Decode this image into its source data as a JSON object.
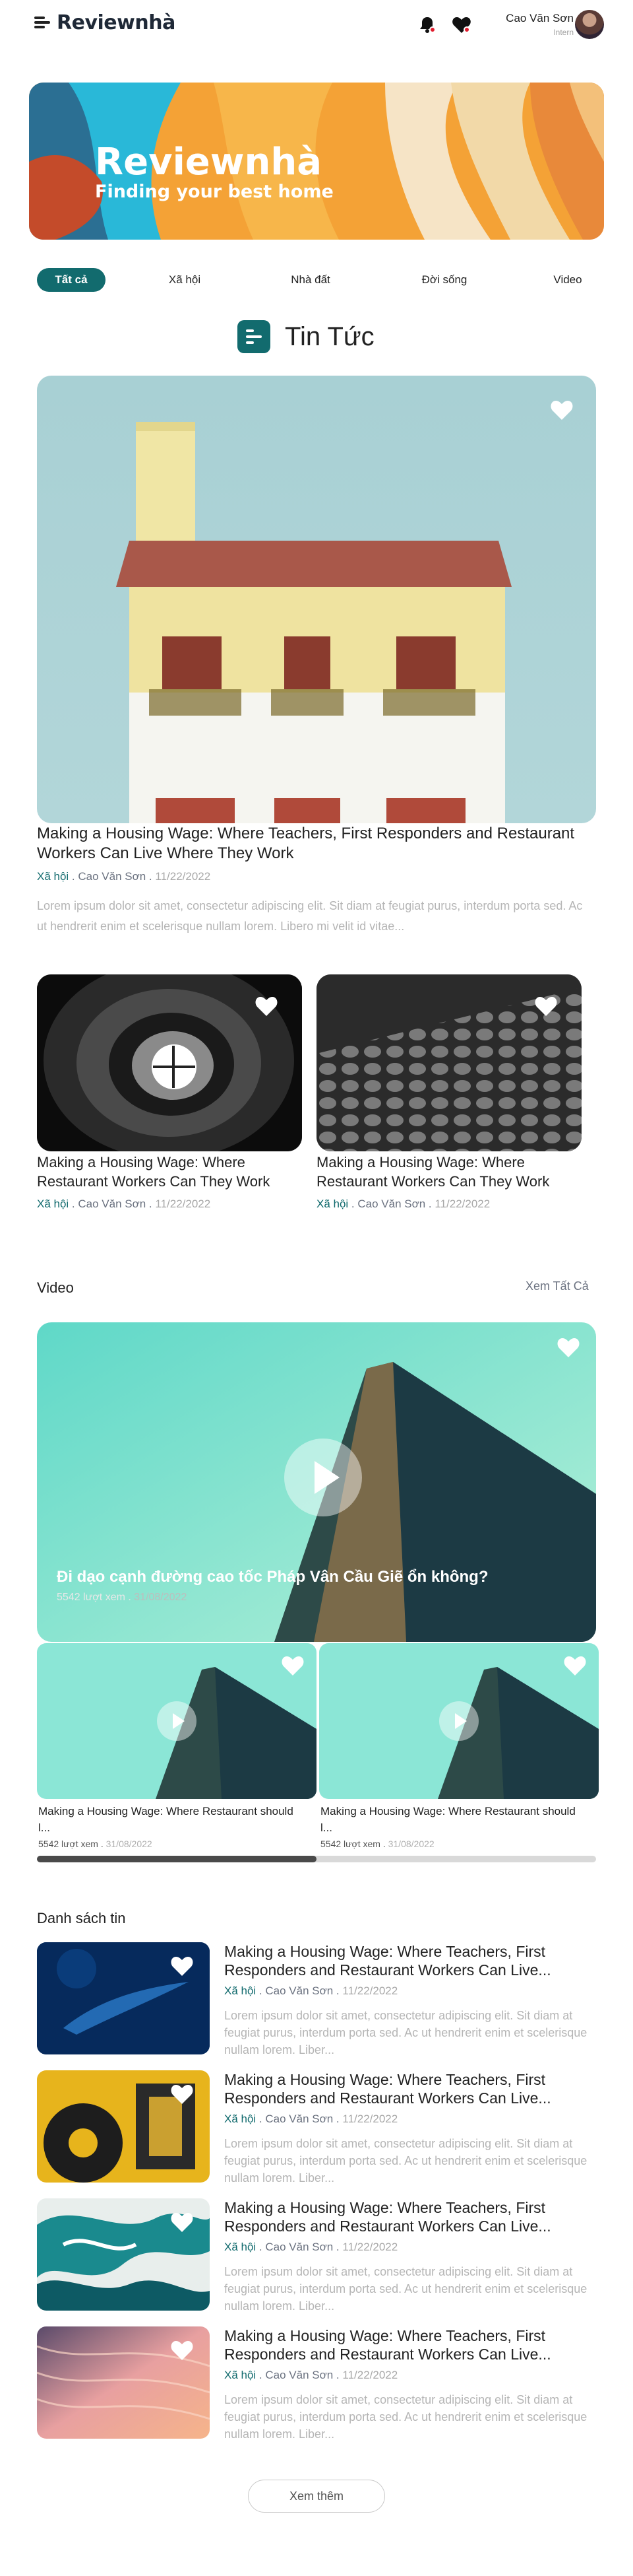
{
  "header": {
    "logo_text": "Reviewnhà",
    "user_name": "Cao Văn Sơn",
    "user_role": "Intern"
  },
  "banner": {
    "title": "Reviewnhà",
    "subtitle": "Finding your best home"
  },
  "tabs": [
    {
      "label": "Tất cả",
      "active": true
    },
    {
      "label": "Xã hội",
      "active": false
    },
    {
      "label": "Nhà đất",
      "active": false
    },
    {
      "label": "Đời sống",
      "active": false
    },
    {
      "label": "Video",
      "active": false
    }
  ],
  "news": {
    "title": "Tin Tức",
    "feature": {
      "title": "Making a Housing Wage: Where Teachers, First Responders and Restaurant Workers Can Live Where They Work",
      "category": "Xã hội",
      "author": "Cao Văn Sơn",
      "date": "11/22/2022",
      "excerpt": "Lorem ipsum dolor sit amet, consectetur adipiscing elit. Sit diam at feugiat purus, interdum porta sed. Ac ut hendrerit enim et scelerisque nullam lorem. Libero mi velit id vitae..."
    },
    "small": [
      {
        "title": "Making a Housing Wage: Where Restaurant Workers Can They Work",
        "category": "Xã hội",
        "author": "Cao Văn Sơn",
        "date": "11/22/2022"
      },
      {
        "title": "Making a Housing Wage: Where Restaurant Workers Can They Work",
        "category": "Xã hội",
        "author": "Cao Văn Sơn",
        "date": "11/22/2022"
      }
    ]
  },
  "video": {
    "title": "Video",
    "see_all": "Xem Tất Cả",
    "main": {
      "title": "Đi dạo cạnh đường cao tốc Pháp Vân Cầu Giẽ ổn không?",
      "views": "5542 lượt xem",
      "date": "31/08/2022"
    },
    "small": [
      {
        "title": "Making a Housing Wage: Where Restaurant should l...",
        "views": "5542 lượt xem",
        "date": "31/08/2022"
      },
      {
        "title": "Making a Housing Wage: Where Restaurant should l...",
        "views": "5542 lượt xem",
        "date": "31/08/2022"
      }
    ],
    "scroll_position": 0.5
  },
  "list": {
    "title": "Danh sách tin",
    "items": [
      {
        "title": "Making a Housing Wage: Where Teachers, First Responders and Restaurant Workers Can Live...",
        "category": "Xã hội",
        "author": "Cao Văn Sơn",
        "date": "11/22/2022",
        "excerpt": "Lorem ipsum dolor sit amet, consectetur adipiscing elit. Sit diam at feugiat purus, interdum porta sed. Ac ut hendrerit enim et scelerisque nullam lorem. Liber..."
      },
      {
        "title": "Making a Housing Wage: Where Teachers, First Responders and Restaurant Workers Can Live...",
        "category": "Xã hội",
        "author": "Cao Văn Sơn",
        "date": "11/22/2022",
        "excerpt": "Lorem ipsum dolor sit amet, consectetur adipiscing elit. Sit diam at feugiat purus, interdum porta sed. Ac ut hendrerit enim et scelerisque nullam lorem. Liber..."
      },
      {
        "title": "Making a Housing Wage: Where Teachers, First Responders and Restaurant Workers Can Live...",
        "category": "Xã hội",
        "author": "Cao Văn Sơn",
        "date": "11/22/2022",
        "excerpt": "Lorem ipsum dolor sit amet, consectetur adipiscing elit. Sit diam at feugiat purus, interdum porta sed. Ac ut hendrerit enim et scelerisque nullam lorem. Liber..."
      },
      {
        "title": "Making a Housing Wage: Where Teachers, First Responders and Restaurant Workers Can Live...",
        "category": "Xã hội",
        "author": "Cao Văn Sơn",
        "date": "11/22/2022",
        "excerpt": "Lorem ipsum dolor sit amet, consectetur adipiscing elit. Sit diam at feugiat purus, interdum porta sed. Ac ut hendrerit enim et scelerisque nullam lorem. Liber..."
      }
    ]
  },
  "more_button": "Xem thêm",
  "colors": {
    "accent": "#126b6e",
    "heart": "#ffffff",
    "notification": "#e11d2e"
  },
  "icons": {
    "menu": "menu-icon",
    "bell": "bell-icon",
    "favorite": "heart-icon",
    "play": "play-icon",
    "news": "news-icon"
  }
}
